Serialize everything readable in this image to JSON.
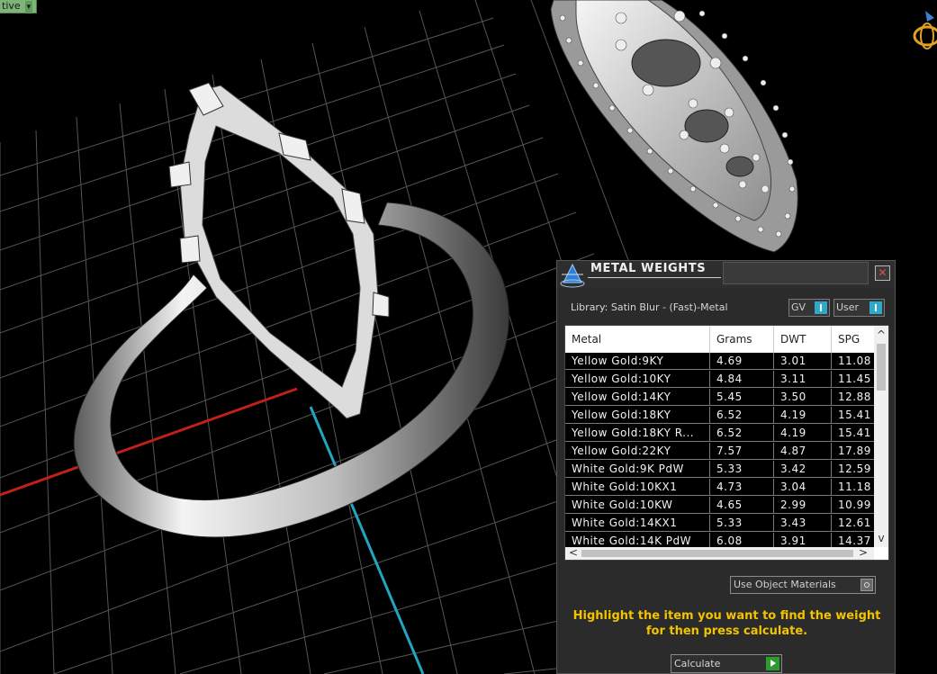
{
  "viewport": {
    "mode_label": "tive",
    "mode_chevron": "▾",
    "colors": {
      "grid": "#555555",
      "x_axis": "#c0201a",
      "y_axis": "#23a6bd",
      "metal": "#d8d8d8"
    }
  },
  "panel": {
    "title": "METAL WEIGHTS",
    "close_glyph": "✕",
    "library": "Library: Satin Blur - (Fast)-Metal",
    "toggles": [
      {
        "label": "GV"
      },
      {
        "label": "User"
      }
    ],
    "table": {
      "columns": [
        "Metal",
        "Grams",
        "DWT",
        "SPG"
      ],
      "rows": [
        [
          "Yellow Gold:9KY",
          "4.69",
          "3.01",
          "11.08"
        ],
        [
          "Yellow Gold:10KY",
          "4.84",
          "3.11",
          "11.45"
        ],
        [
          "Yellow Gold:14KY",
          "5.45",
          "3.50",
          "12.88"
        ],
        [
          "Yellow Gold:18KY",
          "6.52",
          "4.19",
          "15.41"
        ],
        [
          "Yellow Gold:18KY R...",
          "6.52",
          "4.19",
          "15.41"
        ],
        [
          "Yellow Gold:22KY",
          "7.57",
          "4.87",
          "17.89"
        ],
        [
          "White Gold:9K PdW",
          "5.33",
          "3.42",
          "12.59"
        ],
        [
          "White Gold:10KX1",
          "4.73",
          "3.04",
          "11.18"
        ],
        [
          "White Gold:10KW",
          "4.65",
          "2.99",
          "10.99"
        ],
        [
          "White Gold:14KX1",
          "5.33",
          "3.43",
          "12.61"
        ],
        [
          "White Gold:14K PdW",
          "6.08",
          "3.91",
          "14.37"
        ]
      ]
    },
    "scroll": {
      "up": "^",
      "down": "v",
      "left": "<",
      "right": ">"
    },
    "use_object_materials": "Use Object Materials",
    "hint": "Highlight the item you want to find the weight for then press calculate.",
    "calculate_label": "Calculate"
  }
}
